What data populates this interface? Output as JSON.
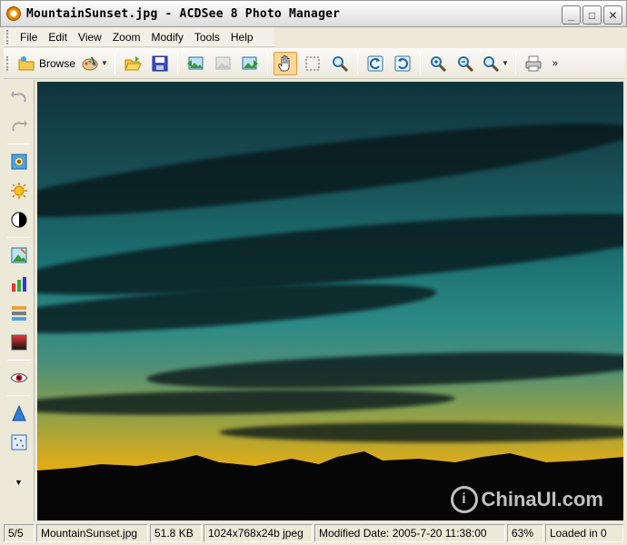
{
  "window": {
    "title": "MountainSunset.jpg - ACDSee 8 Photo Manager",
    "minimize_glyph": "_",
    "maximize_glyph": "□",
    "close_glyph": "✕"
  },
  "menu": {
    "items": [
      {
        "label": "File"
      },
      {
        "label": "Edit"
      },
      {
        "label": "View"
      },
      {
        "label": "Zoom"
      },
      {
        "label": "Modify"
      },
      {
        "label": "Tools"
      },
      {
        "label": "Help"
      }
    ]
  },
  "toolbar": {
    "browse_label": "Browse",
    "active_tool": "hand-tool",
    "overflow_glyph": "»"
  },
  "viewer": {
    "watermark": "ChinaUI.com"
  },
  "status": {
    "position": "5/5",
    "filename": "MountainSunset.jpg",
    "filesize": "51.8 KB",
    "dimensions": "1024x768x24b jpeg",
    "modified": "Modified Date: 2005-7-20 11:38:00",
    "zoom": "63%",
    "loaded": "Loaded in 0"
  },
  "colors": {
    "accent_active": "#ffd897",
    "sky_top": "#10333c",
    "sky_horizon": "#e7b10b"
  }
}
